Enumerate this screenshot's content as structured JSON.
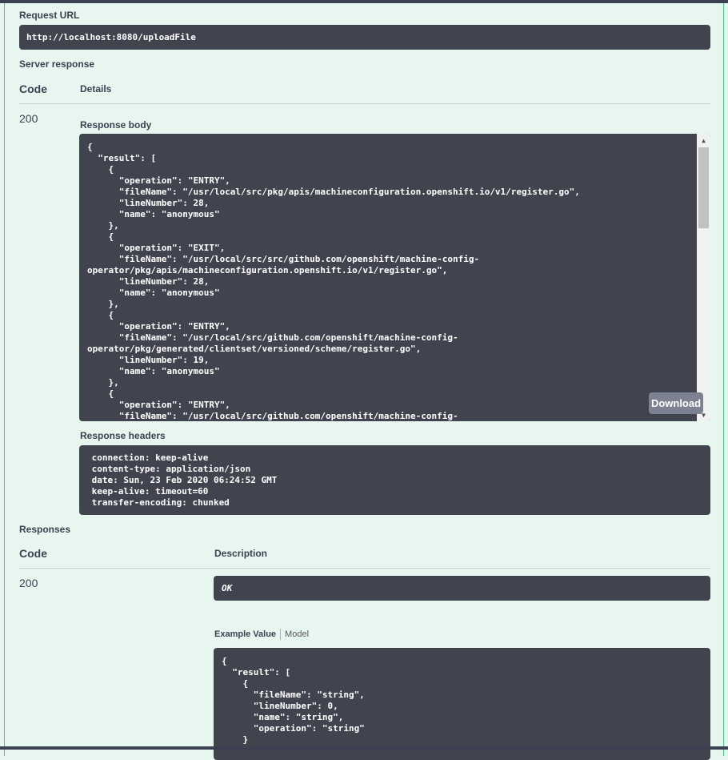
{
  "request_url": {
    "label": "Request URL",
    "value": "http://localhost:8080/uploadFile"
  },
  "server_response": {
    "label": "Server response",
    "code_header": "Code",
    "details_header": "Details",
    "code": "200",
    "response_body_label": "Response body",
    "response_body": "{\n  \"result\": [\n    {\n      \"operation\": \"ENTRY\",\n      \"fileName\": \"/usr/local/src/pkg/apis/machineconfiguration.openshift.io/v1/register.go\",\n      \"lineNumber\": 28,\n      \"name\": \"anonymous\"\n    },\n    {\n      \"operation\": \"EXIT\",\n      \"fileName\": \"/usr/local/src/src/github.com/openshift/machine-config-\noperator/pkg/apis/machineconfiguration.openshift.io/v1/register.go\",\n      \"lineNumber\": 28,\n      \"name\": \"anonymous\"\n    },\n    {\n      \"operation\": \"ENTRY\",\n      \"fileName\": \"/usr/local/src/github.com/openshift/machine-config-\noperator/pkg/generated/clientset/versioned/scheme/register.go\",\n      \"lineNumber\": 19,\n      \"name\": \"anonymous\"\n    },\n    {\n      \"operation\": \"ENTRY\",\n      \"fileName\": \"/usr/local/src/github.com/openshift/machine-config-",
    "download_label": "Download",
    "response_headers_label": "Response headers",
    "response_headers": " connection: keep-alive\n content-type: application/json\n date: Sun, 23 Feb 2020 06:24:52 GMT\n keep-alive: timeout=60\n transfer-encoding: chunked"
  },
  "responses": {
    "label": "Responses",
    "code_header": "Code",
    "description_header": "Description",
    "code": "200",
    "description": "OK",
    "example_value_tab": "Example Value",
    "model_tab": "Model",
    "example_value": "{\n  \"result\": [\n    {\n      \"fileName\": \"string\",\n      \"lineNumber\": 0,\n      \"name\": \"string\",\n      \"operation\": \"string\"\n    }"
  }
}
